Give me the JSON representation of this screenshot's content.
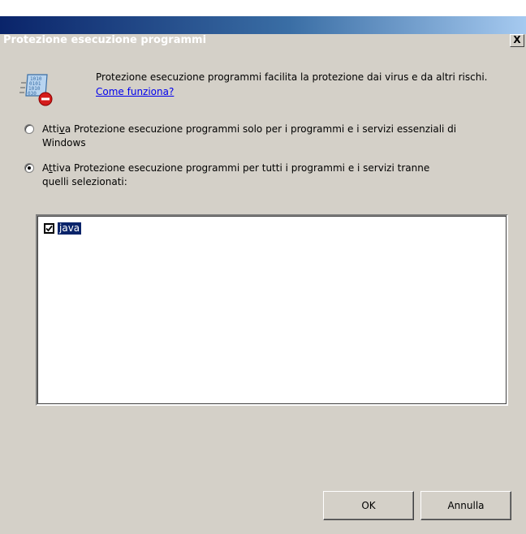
{
  "window": {
    "title": "Protezione esecuzione programmi",
    "close_glyph": "X"
  },
  "info": {
    "icon": "dep-shield-binary-icon",
    "description": "Protezione esecuzione programmi facilita la protezione dai virus e da altri rischi.",
    "help_link": "Come funziona?"
  },
  "options": [
    {
      "pre": "Atti",
      "accel": "v",
      "post": "a Protezione esecuzione programmi solo per i programmi e i servizi essenziali di",
      "line2": "Windows",
      "selected": false
    },
    {
      "pre": "A",
      "accel": "t",
      "post": "tiva Protezione esecuzione programmi per tutti i programmi e i servizi tranne",
      "line2": "quelli selezionati:",
      "selected": true
    }
  ],
  "exceptions": [
    {
      "label": "java",
      "checked": true
    }
  ],
  "buttons": {
    "ok": "OK",
    "cancel": "Annulla"
  }
}
